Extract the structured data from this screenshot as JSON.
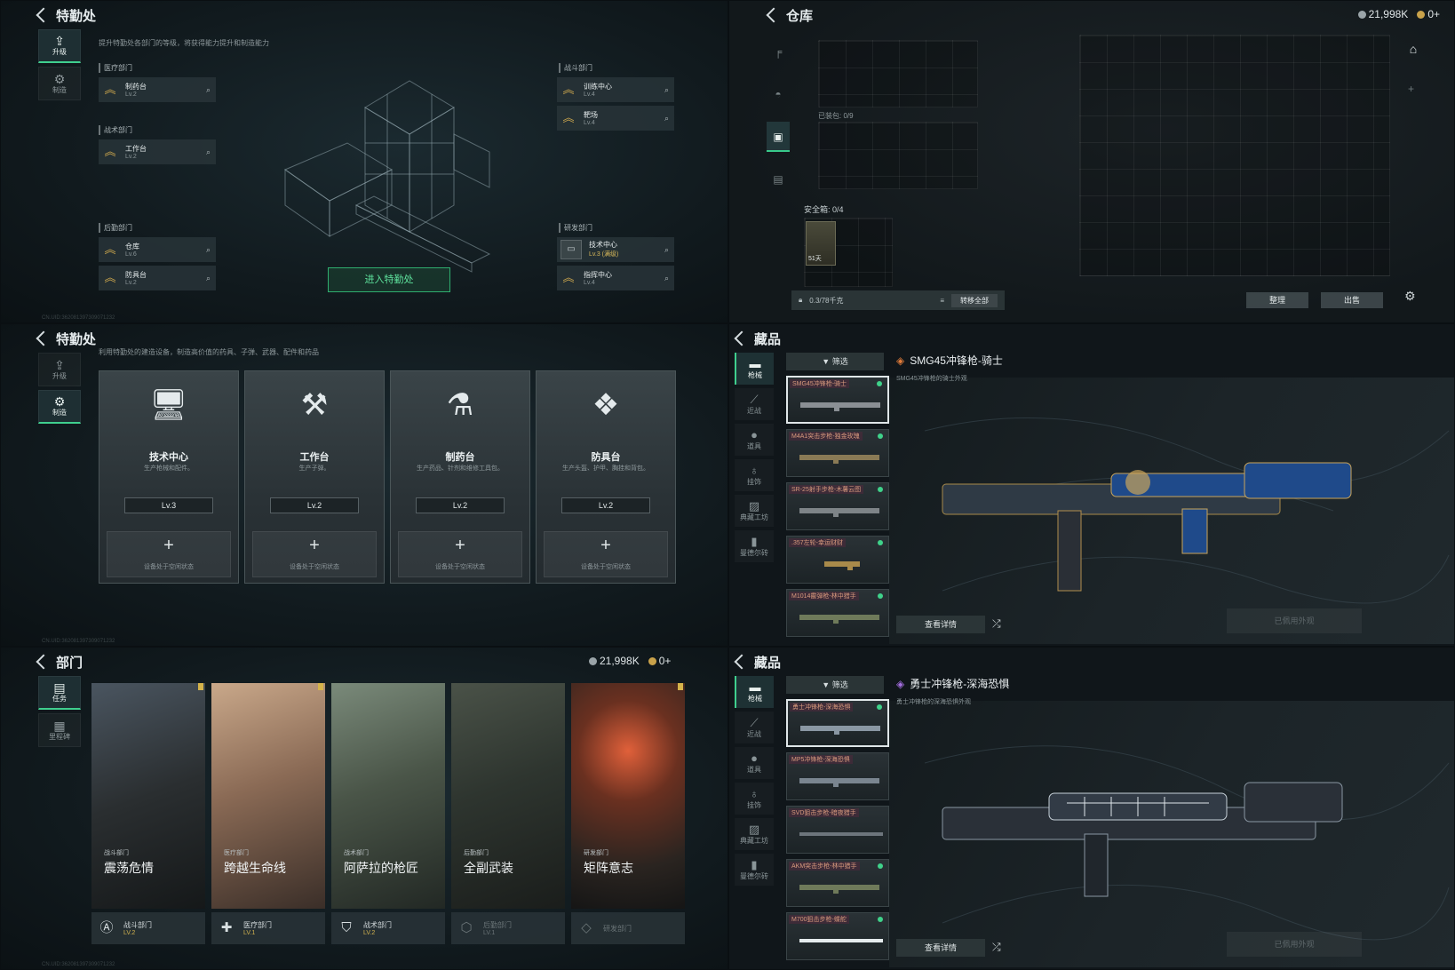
{
  "p1": {
    "title": "特勤处",
    "nav": [
      {
        "label": "升级",
        "icon": "upgrade-icon"
      },
      {
        "label": "制造",
        "icon": "gear-icon"
      }
    ],
    "subtitle": "提升特勤处各部门的等级，将获得能力提升和制造能力",
    "depts": {
      "medical": {
        "label": "医疗部门",
        "items": [
          {
            "name": "制药台",
            "lv": "Lv.2"
          }
        ]
      },
      "tactical": {
        "label": "战术部门",
        "items": [
          {
            "name": "工作台",
            "lv": "Lv.2"
          }
        ]
      },
      "logistics": {
        "label": "后勤部门",
        "items": [
          {
            "name": "仓库",
            "lv": "Lv.6"
          },
          {
            "name": "防具台",
            "lv": "Lv.2"
          }
        ]
      },
      "combat": {
        "label": "战斗部门",
        "items": [
          {
            "name": "训练中心",
            "lv": "Lv.4"
          },
          {
            "name": "靶场",
            "lv": "Lv.4"
          }
        ]
      },
      "research": {
        "label": "研发部门",
        "items": [
          {
            "name": "技术中心",
            "lv": "Lv.3 (满级)"
          },
          {
            "name": "指挥中心",
            "lv": "Lv.4"
          }
        ]
      }
    },
    "enter": "进入特勤处"
  },
  "p2": {
    "title": "仓库",
    "silver": "21,998K",
    "gold": "0+",
    "backpack_label": "已装包: 0/9",
    "safe_label": "安全箱: 0/4",
    "safe_item_time": "51天",
    "weight": "0.3/78千克",
    "transfer_all": "转移全部",
    "sort": "整理",
    "sell": "出售"
  },
  "p3": {
    "title": "特勤处",
    "nav": [
      {
        "label": "升级"
      },
      {
        "label": "制造"
      }
    ],
    "subtitle": "利用特勤处的建造设备，制造高价值的药具、子弹、武器、配件和药品",
    "cards": [
      {
        "name": "技术中心",
        "desc": "生产枪械和配件。",
        "lv": "Lv.3",
        "status": "设备处于空闲状态",
        "icon": "monitor-icon"
      },
      {
        "name": "工作台",
        "desc": "生产子弹。",
        "lv": "Lv.2",
        "status": "设备处于空闲状态",
        "icon": "tools-icon"
      },
      {
        "name": "制药台",
        "desc": "生产药品、针剂和维修工具包。",
        "lv": "Lv.2",
        "status": "设备处于空闲状态",
        "icon": "microscope-icon"
      },
      {
        "name": "防具台",
        "desc": "生产头盔、护甲、胸挂和背包。",
        "lv": "Lv.2",
        "status": "设备处于空闲状态",
        "icon": "cubes-icon"
      }
    ]
  },
  "p4": {
    "title": "藏品",
    "nav": [
      "枪械",
      "近战",
      "道具",
      "挂饰",
      "典藏工坊",
      "曼德尔砖"
    ],
    "filter": "筛选",
    "skin_title": "SMG45冲锋枪-骑士",
    "skin_sub": "SMG45冲锋枪的骑士外观",
    "skins": [
      "SMG45冲锋枪-骑士",
      "M4A1突击步枪-独金玫瑰",
      "SR-25射手步枪-木薯云图",
      ".357左轮-幸运财财",
      "M1014霰弹枪-林中猎手"
    ],
    "detail": "查看详情",
    "equipped": "已佩用外观"
  },
  "p5": {
    "title": "部门",
    "silver": "21,998K",
    "gold": "0+",
    "nav": [
      {
        "label": "任务"
      },
      {
        "label": "里程碑"
      }
    ],
    "cards": [
      {
        "tag": "战斗部门",
        "name": "震荡危情",
        "dept": "战斗部门",
        "lv": "LV.2"
      },
      {
        "tag": "医疗部门",
        "name": "跨越生命线",
        "dept": "医疗部门",
        "lv": "LV.1"
      },
      {
        "tag": "战术部门",
        "name": "阿萨拉的枪匠",
        "dept": "战术部门",
        "lv": "LV.2"
      },
      {
        "tag": "后勤部门",
        "name": "全副武装",
        "dept": "后勤部门",
        "lv": "LV.1"
      },
      {
        "tag": "研发部门",
        "name": "矩阵意志",
        "dept": "研发部门",
        "lv": ""
      }
    ]
  },
  "p6": {
    "title": "藏品",
    "nav": [
      "枪械",
      "近战",
      "道具",
      "挂饰",
      "典藏工坊",
      "曼德尔砖"
    ],
    "filter": "筛选",
    "skin_title": "勇士冲锋枪-深海恐惧",
    "skin_sub": "勇士冲锋枪的深海恐惧外观",
    "skins": [
      "勇士冲锋枪-深海恐惧",
      "MP5冲锋枪-深海恐惧",
      "SVD狙击步枪-暗夜猎手",
      "AKM突击步枪-林中猎手",
      "M700狙击步枪-蝶舵"
    ],
    "detail": "查看详情",
    "equipped": "已佩用外观"
  },
  "uid": "CN.UID:362081397309071232"
}
